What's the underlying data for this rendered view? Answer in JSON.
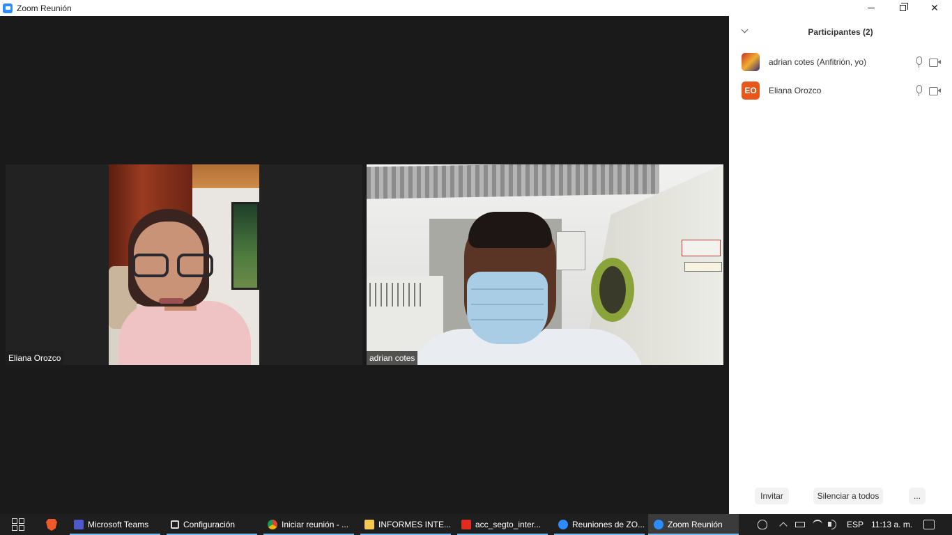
{
  "window": {
    "title": "Zoom Reunión"
  },
  "videos": [
    {
      "name": "Eliana Orozco"
    },
    {
      "name": "adrian cotes"
    }
  ],
  "panel": {
    "title": "Participantes (2)",
    "participants": [
      {
        "initials": "",
        "name": "adrian cotes (Anfitrión, yo)"
      },
      {
        "initials": "EO",
        "name": "Eliana Orozco"
      }
    ],
    "buttons": {
      "invite": "Invitar",
      "mute_all": "Silenciar a todos",
      "more": "..."
    }
  },
  "taskbar": {
    "apps": [
      {
        "label": "Microsoft Teams",
        "icon": "teams-icon"
      },
      {
        "label": "Configuración",
        "icon": "gear-icon"
      },
      {
        "label": "Iniciar reunión - ...",
        "icon": "chrome-icon"
      },
      {
        "label": "INFORMES INTE...",
        "icon": "folder-icon"
      },
      {
        "label": "acc_segto_inter...",
        "icon": "pdf-icon"
      },
      {
        "label": "Reuniones de ZO...",
        "icon": "zoom-icon"
      },
      {
        "label": "Zoom Reunión",
        "icon": "zoom-icon"
      }
    ],
    "tray": {
      "language": "ESP",
      "time": "11:13 a. m."
    }
  },
  "colors": {
    "accent": "#2d8cff",
    "taskbar": "#1f1f1f",
    "video_bg": "#1a1a1a",
    "avatar_eo": "#e8561a"
  }
}
